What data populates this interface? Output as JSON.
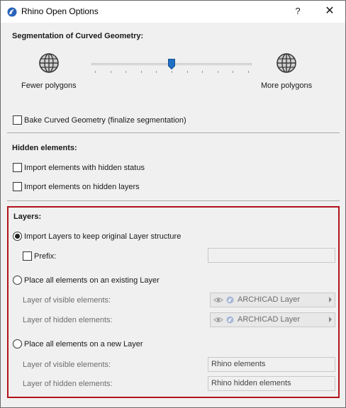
{
  "window": {
    "title": "Rhino Open Options",
    "help_label": "?",
    "close_label": "✕"
  },
  "segmentation": {
    "heading": "Segmentation of Curved Geometry:",
    "fewer_label": "Fewer polygons",
    "more_label": "More polygons",
    "slider_position_step": 5,
    "slider_steps": 10,
    "bake_label": "Bake Curved Geometry (finalize segmentation)",
    "bake_checked": false
  },
  "hidden": {
    "heading": "Hidden elements:",
    "import_hidden_status_label": "Import elements with hidden status",
    "import_hidden_status_checked": false,
    "import_hidden_layers_label": "Import elements on hidden layers",
    "import_hidden_layers_checked": false
  },
  "layers": {
    "heading": "Layers:",
    "option_keep_label": "Import Layers to keep original Layer structure",
    "option_keep_selected": true,
    "prefix_label": "Prefix:",
    "prefix_checked": false,
    "prefix_value": "",
    "option_existing_label": "Place all elements on an existing Layer",
    "option_existing_selected": false,
    "existing_visible_label": "Layer of visible elements:",
    "existing_visible_value": "ARCHICAD Layer",
    "existing_hidden_label": "Layer of hidden elements:",
    "existing_hidden_value": "ARCHICAD Layer",
    "option_new_label": "Place all elements on a new Layer",
    "option_new_selected": false,
    "new_visible_label": "Layer of visible elements:",
    "new_visible_value": "Rhino elements",
    "new_hidden_label": "Layer of hidden elements:",
    "new_hidden_value": "Rhino hidden elements"
  },
  "colors": {
    "highlight": "#b0141a",
    "thumb": "#1f6fc5"
  },
  "icons": {
    "app": "rhino-app-icon",
    "globe": "globe-icon",
    "eye": "eye-icon",
    "layer": "layer-icon"
  }
}
